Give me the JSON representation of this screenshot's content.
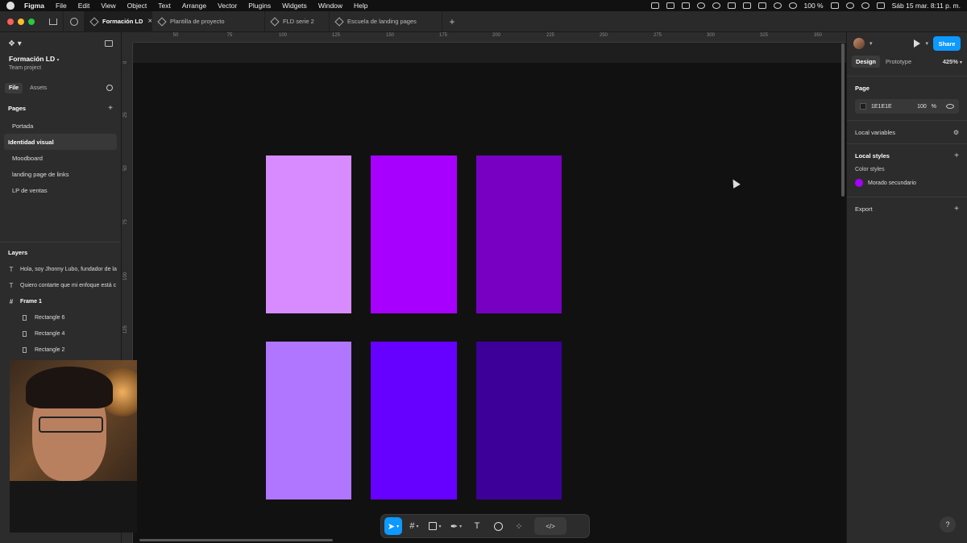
{
  "menubar": {
    "app": "Figma",
    "items": [
      "File",
      "Edit",
      "View",
      "Object",
      "Text",
      "Arrange",
      "Vector",
      "Plugins",
      "Widgets",
      "Window",
      "Help"
    ],
    "battery": "100 %",
    "datetime": "Sáb 15 mar.  8:11 p. m."
  },
  "tabs": [
    {
      "label": "Formación LD",
      "active": true
    },
    {
      "label": "Plantilla de proyecto"
    },
    {
      "label": "FLD serie 2"
    },
    {
      "label": "Escuela de landing pages"
    }
  ],
  "left": {
    "project_name": "Formación LD",
    "project_sub": "Team project",
    "tab_file": "File",
    "tab_assets": "Assets",
    "pages_title": "Pages",
    "pages": [
      "Portada",
      "Identidad visual",
      "Moodboard",
      "landing page de links",
      "LP de ventas"
    ],
    "selected_page_index": 1,
    "layers_title": "Layers",
    "layers": [
      {
        "label": "Hola, soy Jhonny Lubo, fundador de la",
        "icon": "text-icon"
      },
      {
        "label": "Quiero contarte que mi enfoque está c",
        "icon": "text-icon"
      },
      {
        "label": "Frame 1",
        "icon": "frame-icon"
      },
      {
        "label": "Rectangle 6",
        "icon": "rectangle-icon"
      },
      {
        "label": "Rectangle 4",
        "icon": "rectangle-icon"
      },
      {
        "label": "Rectangle 2",
        "icon": "rectangle-icon"
      }
    ]
  },
  "ruler": {
    "x_ticks": [
      "50",
      "75",
      "100",
      "125",
      "150",
      "175",
      "200",
      "225",
      "250",
      "275",
      "300",
      "325",
      "350"
    ],
    "y_ticks": [
      "0",
      "25",
      "50",
      "75",
      "100",
      "125"
    ]
  },
  "swatches": [
    {
      "color": "#d88bff"
    },
    {
      "color": "#a800ff"
    },
    {
      "color": "#7800c2"
    },
    {
      "color": "#b076ff"
    },
    {
      "color": "#6600ff"
    },
    {
      "color": "#3d0099"
    }
  ],
  "right": {
    "share": "Share",
    "tab_design": "Design",
    "tab_prototype": "Prototype",
    "zoom": "425%",
    "page_title": "Page",
    "page_fill_hex": "1E1E1E",
    "page_fill_opacity": "100",
    "page_fill_unit": "%",
    "local_variables": "Local variables",
    "local_styles": "Local styles",
    "color_styles_label": "Color styles",
    "color_style_name": "Morado secundario",
    "color_style_color": "#a800ff",
    "export": "Export"
  },
  "help": "?"
}
